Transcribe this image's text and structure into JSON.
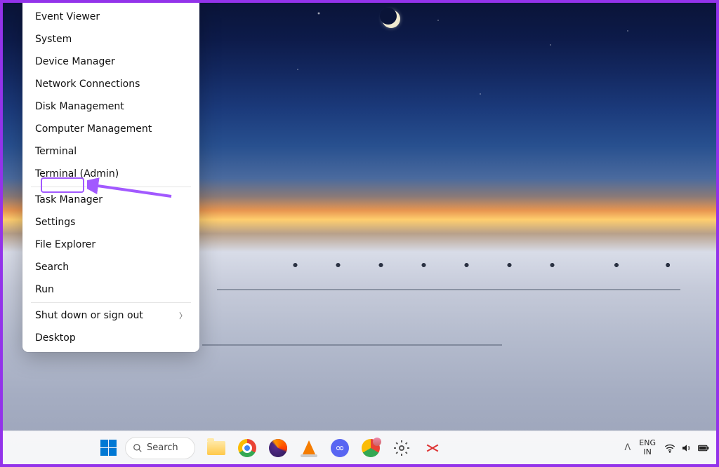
{
  "menu": {
    "items": [
      {
        "label": "Event Viewer"
      },
      {
        "label": "System"
      },
      {
        "label": "Device Manager"
      },
      {
        "label": "Network Connections"
      },
      {
        "label": "Disk Management"
      },
      {
        "label": "Computer Management"
      },
      {
        "label": "Terminal"
      },
      {
        "label": "Terminal (Admin)"
      },
      {
        "label": "Task Manager"
      },
      {
        "label": "Settings"
      },
      {
        "label": "File Explorer"
      },
      {
        "label": "Search"
      },
      {
        "label": "Run"
      },
      {
        "label": "Shut down or sign out"
      },
      {
        "label": "Desktop"
      }
    ]
  },
  "taskbar": {
    "search_label": "Search",
    "lang_top": "ENG",
    "lang_bottom": "IN"
  }
}
